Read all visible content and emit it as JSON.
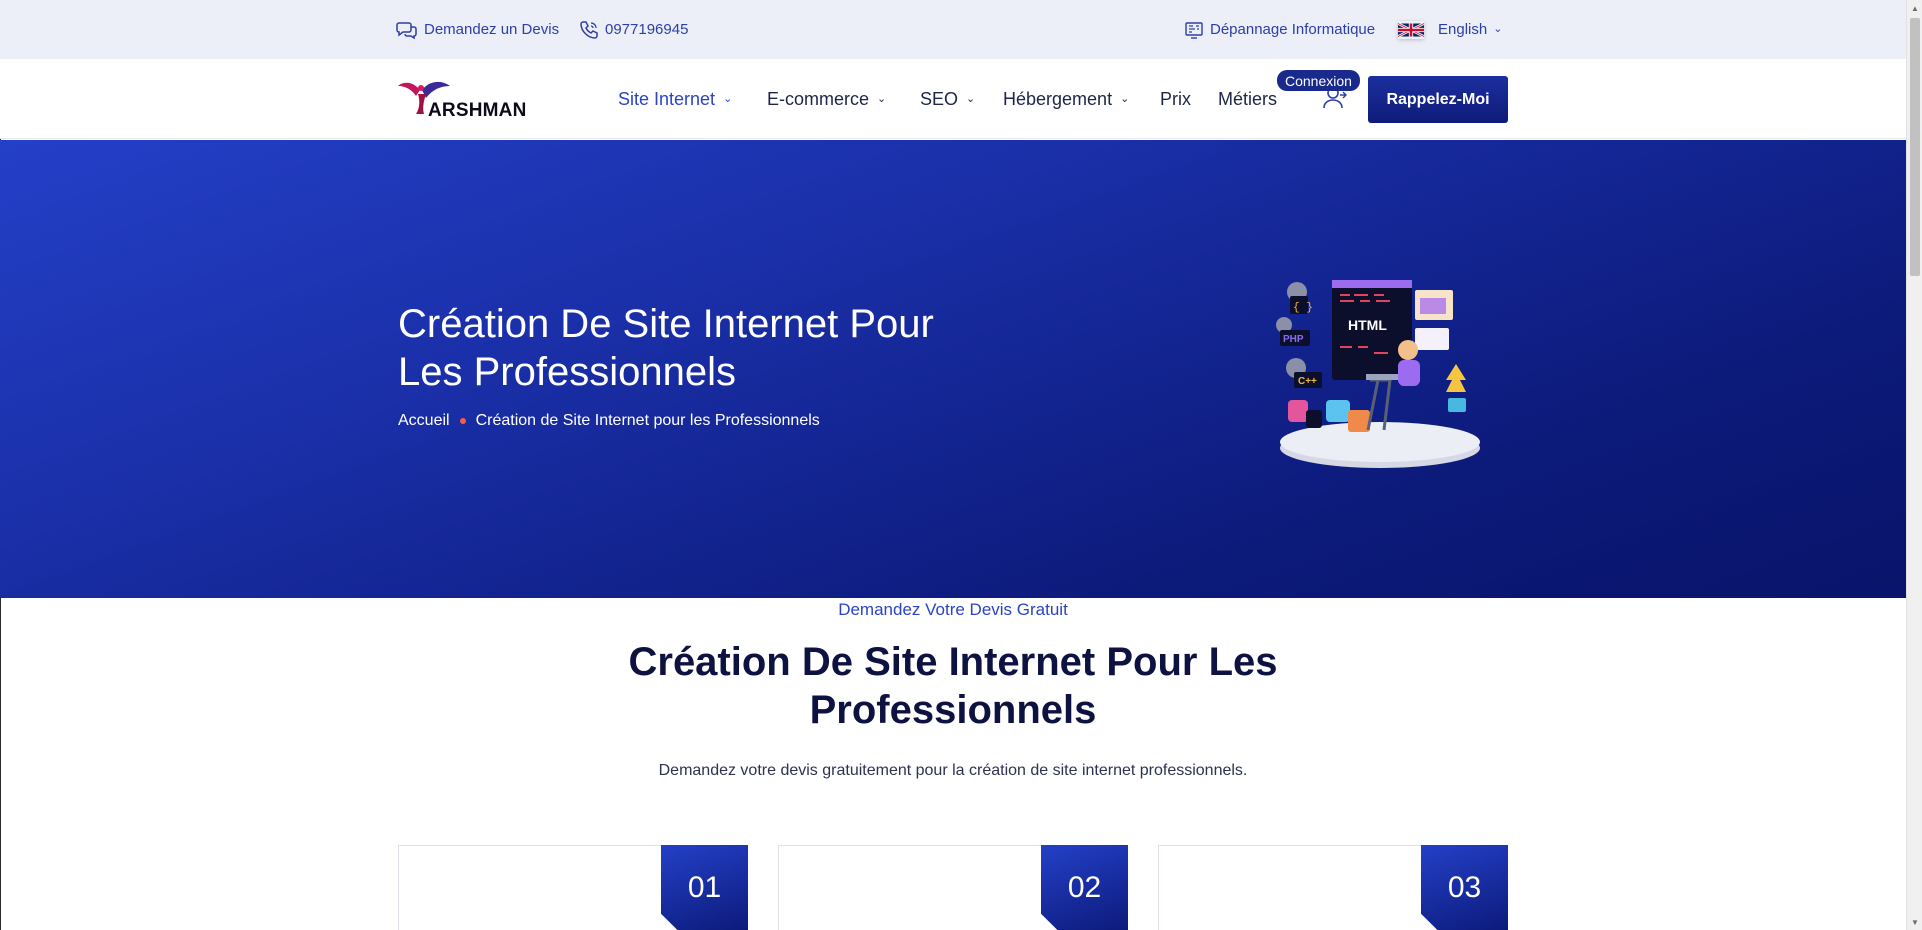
{
  "topbar": {
    "quote_label": "Demandez un Devis",
    "phone_label": "0977196945",
    "it_repair_label": "Dépannage Informatique",
    "language_label": "English"
  },
  "header": {
    "logo_text": "ARSHMAN",
    "nav": [
      {
        "label": "Site Internet",
        "has_dropdown": true,
        "active": true
      },
      {
        "label": "E-commerce",
        "has_dropdown": true,
        "active": false
      },
      {
        "label": "SEO",
        "has_dropdown": true,
        "active": false
      },
      {
        "label": "Hébergement",
        "has_dropdown": true,
        "active": false
      },
      {
        "label": "Prix",
        "has_dropdown": false,
        "active": false
      },
      {
        "label": "Métiers",
        "has_dropdown": false,
        "active": false
      }
    ],
    "login_badge": "Connexion",
    "cta_label": "Rappelez-Moi"
  },
  "hero": {
    "title": "Création De Site Internet Pour Les Professionnels",
    "breadcrumb": {
      "home": "Accueil",
      "current": "Création de Site Internet pour les Professionnels"
    },
    "illustration_tags": [
      "HTML",
      "PHP",
      "C++",
      "{ }"
    ]
  },
  "intro": {
    "eyebrow": "Demandez Votre Devis Gratuit",
    "title": "Création De Site Internet Pour Les Professionnels",
    "description": "Demandez votre devis gratuitement pour la création de site internet professionnels."
  },
  "cards": [
    {
      "number": "01"
    },
    {
      "number": "02"
    },
    {
      "number": "03"
    }
  ],
  "colors": {
    "primary": "#1a2fa8",
    "primary_dark": "#0c1a7a",
    "topbar_bg": "#eceef8",
    "accent_dot": "#ff5a3c"
  },
  "icons": {
    "quote": "chat-bubbles-icon",
    "phone": "phone-icon",
    "it_repair": "monitor-code-icon",
    "language_flag": "uk-flag-icon",
    "user": "user-login-icon"
  }
}
